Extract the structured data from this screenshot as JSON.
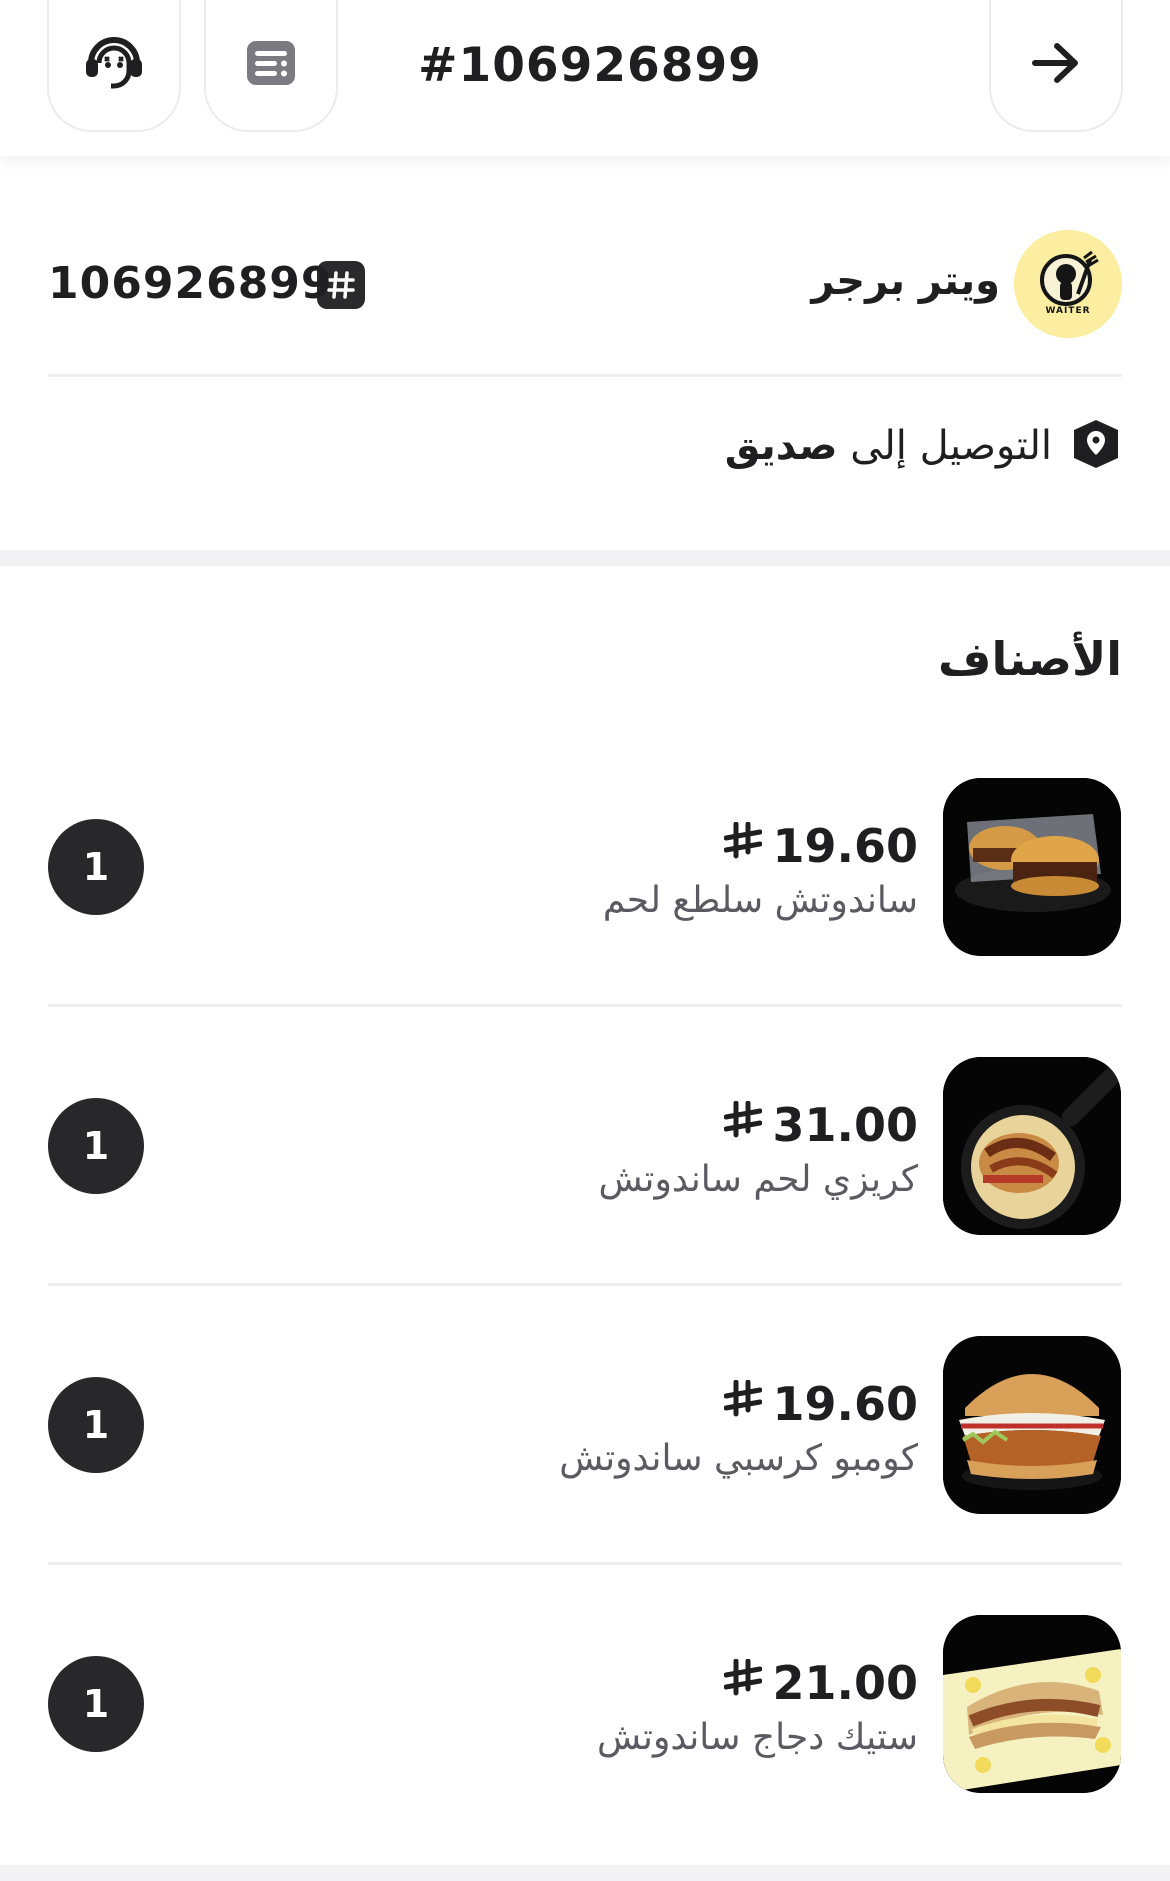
{
  "header": {
    "order_title": "#106926899",
    "icons": [
      "headset-icon",
      "receipt-icon",
      "arrow-right-icon"
    ]
  },
  "restaurant": {
    "name": "ويتر برجر",
    "order_number": "106926899",
    "logo_text": "WAITER"
  },
  "delivery": {
    "label_prefix": "التوصيل إلى",
    "label_target": "صديق"
  },
  "items_section": {
    "title": "الأصناف",
    "items": [
      {
        "price": "19.60",
        "name": "ساندوتش سلطع لحم",
        "qty": "1"
      },
      {
        "price": "31.00",
        "name": "كريزي لحم ساندوتش",
        "qty": "1"
      },
      {
        "price": "19.60",
        "name": "كومبو كرسبي ساندوتش",
        "qty": "1"
      },
      {
        "price": "21.00",
        "name": "ستيك دجاج ساندوتش",
        "qty": "1"
      }
    ]
  },
  "colors": {
    "text": "#1f1f22",
    "muted": "#5a5a60",
    "badge": "#28282b",
    "logo_bg": "#fbeea0",
    "divider": "#efeff1"
  }
}
